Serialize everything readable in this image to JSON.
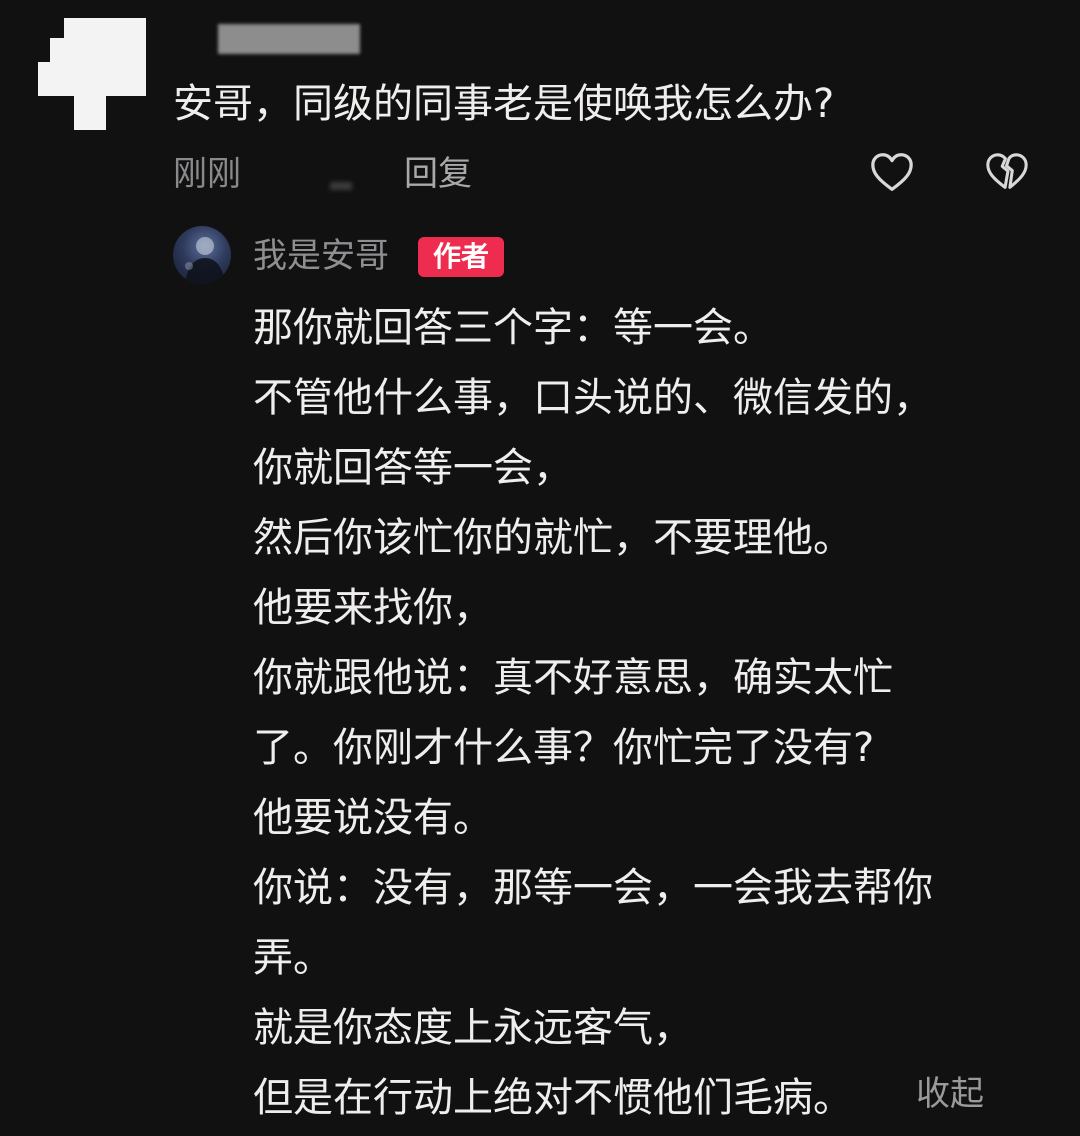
{
  "comment": {
    "text": "安哥，同级的同事老是使唤我怎么办?",
    "time": "刚刚",
    "reply_label": "回复",
    "like_icon": "heart-icon",
    "dislike_icon": "broken-heart-icon"
  },
  "reply": {
    "username": "我是安哥",
    "badge": "作者",
    "lines": [
      "那你就回答三个字：等一会。",
      "不管他什么事，口头说的、微信发的，",
      "你就回答等一会，",
      "然后你该忙你的就忙，不要理他。",
      "他要来找你，",
      "你就跟他说：真不好意思，确实太忙",
      "了。你刚才什么事？你忙完了没有?",
      "他要说没有。",
      "你说：没有，那等一会，一会我去帮你",
      "弄。",
      "就是你态度上永远客气，",
      "但是在行动上绝对不惯他们毛病。"
    ],
    "collapse_label": "收起"
  },
  "colors": {
    "background": "#111112",
    "text": "#efeeed",
    "muted": "#8a8a8c",
    "badge": "#ee2c4f"
  }
}
